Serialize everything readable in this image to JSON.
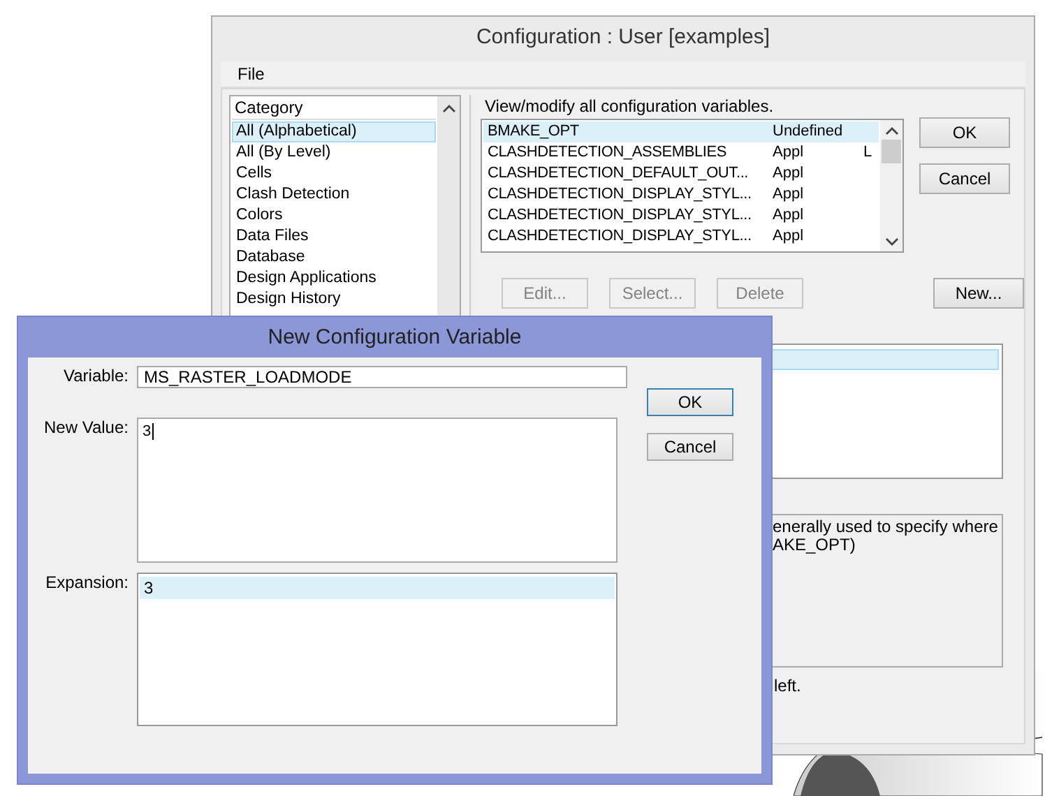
{
  "main_window": {
    "title": "Configuration : User [examples]",
    "menu": [
      "File"
    ],
    "category_list": {
      "header": "Category",
      "items": [
        {
          "label": "All (Alphabetical)",
          "selected": true
        },
        {
          "label": "All (By Level)",
          "selected": false
        },
        {
          "label": "Cells",
          "selected": false
        },
        {
          "label": "Clash Detection",
          "selected": false
        },
        {
          "label": "Colors",
          "selected": false
        },
        {
          "label": "Data Files",
          "selected": false
        },
        {
          "label": "Database",
          "selected": false
        },
        {
          "label": "Design Applications",
          "selected": false
        },
        {
          "label": "Design History",
          "selected": false
        }
      ]
    },
    "variables_caption": "View/modify all configuration variables.",
    "variables": [
      {
        "name": "BMAKE_OPT",
        "scope": "Undefined",
        "selected": true
      },
      {
        "name": "CLASHDETECTION_ASSEMBLIES",
        "scope": "Appl",
        "flag": "L",
        "selected": false
      },
      {
        "name": "CLASHDETECTION_DEFAULT_OUT...",
        "scope": "Appl",
        "selected": false
      },
      {
        "name": "CLASHDETECTION_DISPLAY_STYL...",
        "scope": "Appl",
        "selected": false
      },
      {
        "name": "CLASHDETECTION_DISPLAY_STYL...",
        "scope": "Appl",
        "selected": false
      },
      {
        "name": "CLASHDETECTION_DISPLAY_STYL...",
        "scope": "Appl",
        "selected": false
      }
    ],
    "side_buttons": [
      {
        "label": "OK",
        "disabled": false
      },
      {
        "label": "Cancel",
        "disabled": false
      }
    ],
    "action_buttons": [
      {
        "label": "Edit...",
        "disabled": true
      },
      {
        "label": "Select...",
        "disabled": true
      },
      {
        "label": "Delete",
        "disabled": true
      },
      {
        "label": "New...",
        "disabled": false
      }
    ],
    "levels_list": {
      "has_selection": true
    },
    "description_lines": [
      "enerally used to specify where",
      "AKE_OPT)"
    ],
    "footer_text": "left."
  },
  "dialog": {
    "title": "New Configuration Variable",
    "variable_label": "Variable:",
    "variable_value": "MS_RASTER_LOADMODE",
    "new_value_label": "New Value:",
    "new_value": "3",
    "expansion_label": "Expansion:",
    "expansion_items": [
      {
        "label": "3",
        "selected": true
      }
    ],
    "buttons": [
      {
        "label": "OK",
        "default": true
      },
      {
        "label": "Cancel",
        "default": false
      }
    ]
  }
}
